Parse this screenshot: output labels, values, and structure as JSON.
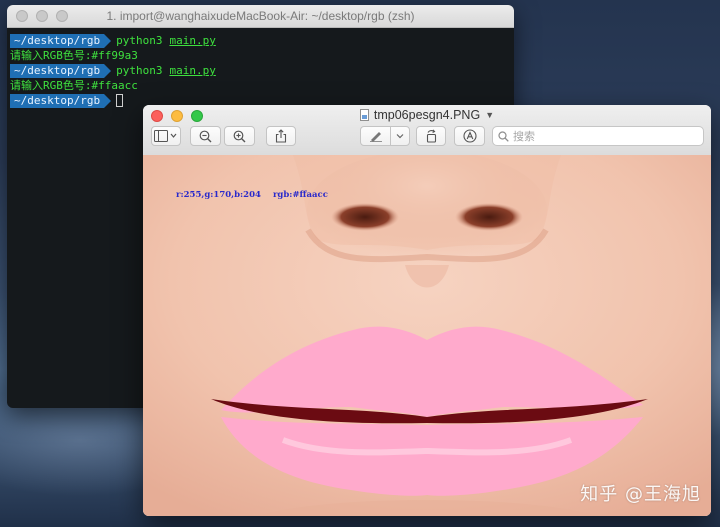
{
  "terminal": {
    "title": "1. import@wanghaixudeMacBook-Air: ~/desktop/rgb (zsh)",
    "prompt": "~/desktop/rgb",
    "lines": [
      {
        "command": "python3",
        "arg": "main.py"
      },
      {
        "output": "请输入RGB色号:#ff99a3"
      },
      {
        "command": "python3",
        "arg": "main.py"
      },
      {
        "output": "请输入RGB色号:#ffaacc"
      }
    ]
  },
  "preview": {
    "title": "tmp06pesgn4.PNG",
    "search": {
      "placeholder": "搜索"
    },
    "overlay": {
      "rgb_values": "r:255,g:170,b:204",
      "hex_value": "rgb:#ffaacc"
    },
    "lip_color": "#ffaacc",
    "watermark": "知乎 @王海旭"
  }
}
